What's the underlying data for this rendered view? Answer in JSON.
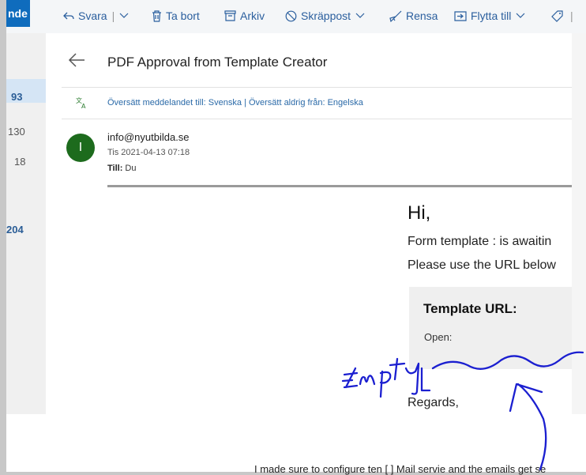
{
  "toolbar": {
    "new_label": "nde",
    "reply_label": "Svara",
    "delete_label": "Ta bort",
    "archive_label": "Arkiv",
    "junk_label": "Skräppost",
    "sweep_label": "Rensa",
    "move_label": "Flytta till"
  },
  "folder_counts": [
    "93",
    "130",
    "18",
    "204"
  ],
  "email": {
    "subject": "PDF Approval from Template Creator",
    "translate_bar": "Översätt meddelandet till: Svenska | Översätt aldrig från: Engelska",
    "avatar_letter": "I",
    "from": "info@nyutbilda.se",
    "date": "Tis 2021-04-13 07:18",
    "to_label": "Till:",
    "to_value": "Du",
    "body_greeting": "Hi,",
    "body_line1": "Form template : is awaitin",
    "body_line2": "Please use the URL below",
    "url_box_title": "Template URL:",
    "url_box_open": "Open:",
    "regards": "Regards,"
  },
  "annotation": {
    "handwritten_text": "Empty"
  },
  "bottom_caption": "I made sure to configure ten [ ] Mail servie and the emails get se"
}
